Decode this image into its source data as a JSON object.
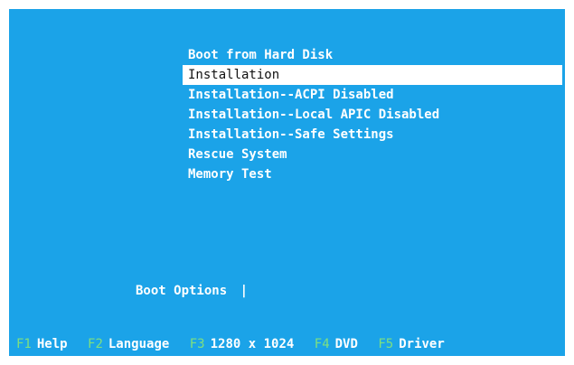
{
  "menu": {
    "items": [
      {
        "label": "Boot from Hard Disk"
      },
      {
        "label": "Installation"
      },
      {
        "label": "Installation--ACPI Disabled"
      },
      {
        "label": "Installation--Local APIC Disabled"
      },
      {
        "label": "Installation--Safe Settings"
      },
      {
        "label": "Rescue System"
      },
      {
        "label": "Memory Test"
      }
    ],
    "selected_index": 1
  },
  "boot_options": {
    "label": "Boot Options",
    "value": "|"
  },
  "function_keys": [
    {
      "key": "F1",
      "label": "Help"
    },
    {
      "key": "F2",
      "label": "Language"
    },
    {
      "key": "F3",
      "label": "1280 x 1024"
    },
    {
      "key": "F4",
      "label": "DVD"
    },
    {
      "key": "F5",
      "label": "Driver"
    }
  ],
  "colors": {
    "background": "#1ba3e8",
    "text": "#ffffff",
    "selection_bg": "#ffffff",
    "selection_text": "#111111",
    "function_key": "#7fe07f"
  }
}
